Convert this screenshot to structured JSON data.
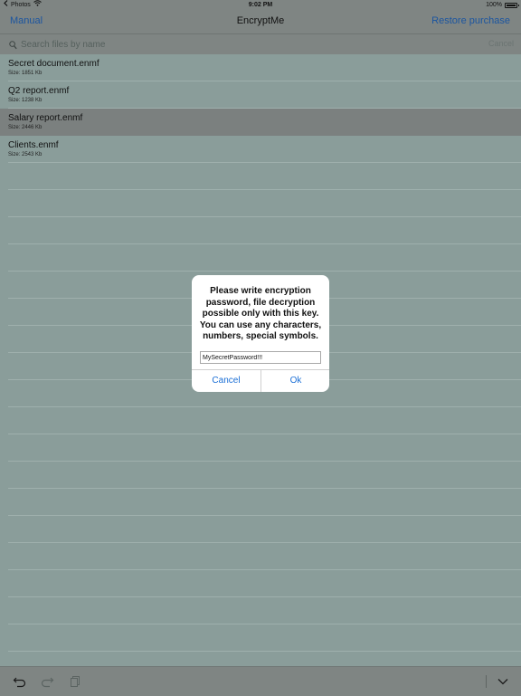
{
  "status_bar": {
    "back_app": "Photos",
    "time": "9:02 PM",
    "battery_percent": "100%",
    "battery_level": 1.0
  },
  "nav": {
    "left_button": "Manual",
    "title": "EncryptMe",
    "right_button": "Restore purchase"
  },
  "search": {
    "placeholder": "Search files by name",
    "cancel_label": "Cancel"
  },
  "files": [
    {
      "name": "Secret document.enmf",
      "size": "Size: 1851 Kb"
    },
    {
      "name": "Q2 report.enmf",
      "size": "Size: 1238 Kb"
    },
    {
      "name": "Salary report.enmf",
      "size": "Size: 2446 Kb"
    },
    {
      "name": "Clients.enmf",
      "size": "Size: 2543 Kb"
    }
  ],
  "dialog": {
    "message": "Please write encryption password, file decryption possible only with this key. You can use any characters, numbers, special symbols.",
    "input_value": "MySecretPassword!!!",
    "cancel_label": "Cancel",
    "ok_label": "Ok"
  },
  "toolbar": {
    "icons": [
      "undo-icon",
      "redo-icon",
      "paste-icon",
      "chevron-down-icon"
    ]
  },
  "colors": {
    "accent": "#1b6fd6",
    "background_tint": "#8a9d9a"
  }
}
